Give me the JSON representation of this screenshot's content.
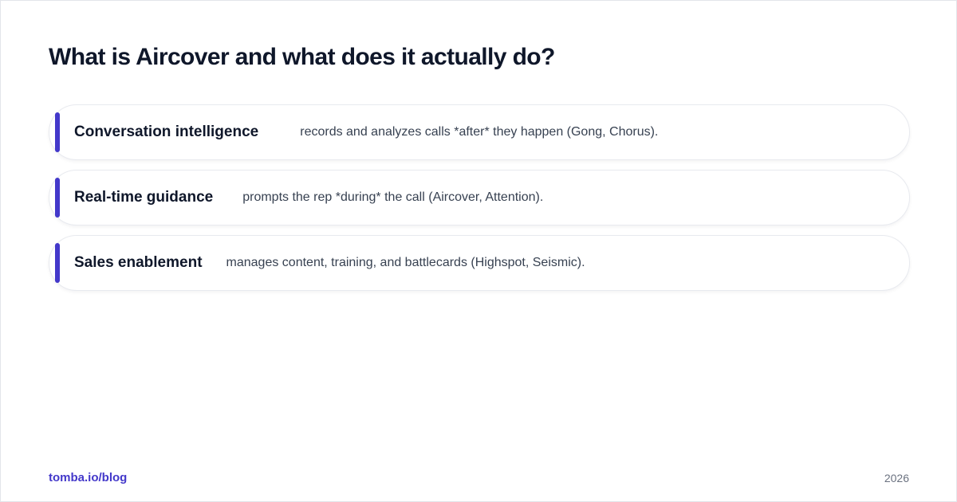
{
  "title": "What is Aircover and what does it actually do?",
  "colors": {
    "accent": "#4338ca",
    "heading": "#0f172a",
    "body_text": "#374151",
    "muted": "#6b7280"
  },
  "rows": [
    {
      "term": "Conversation intelligence",
      "description": "records and analyzes calls *after* they happen (Gong, Chorus)."
    },
    {
      "term": "Real-time guidance",
      "description": "prompts the rep *during* the call (Aircover, Attention)."
    },
    {
      "term": "Sales enablement",
      "description": "manages content, training, and battlecards (Highspot, Seismic)."
    }
  ],
  "footer": {
    "link": "tomba.io/blog",
    "year": "2026"
  }
}
